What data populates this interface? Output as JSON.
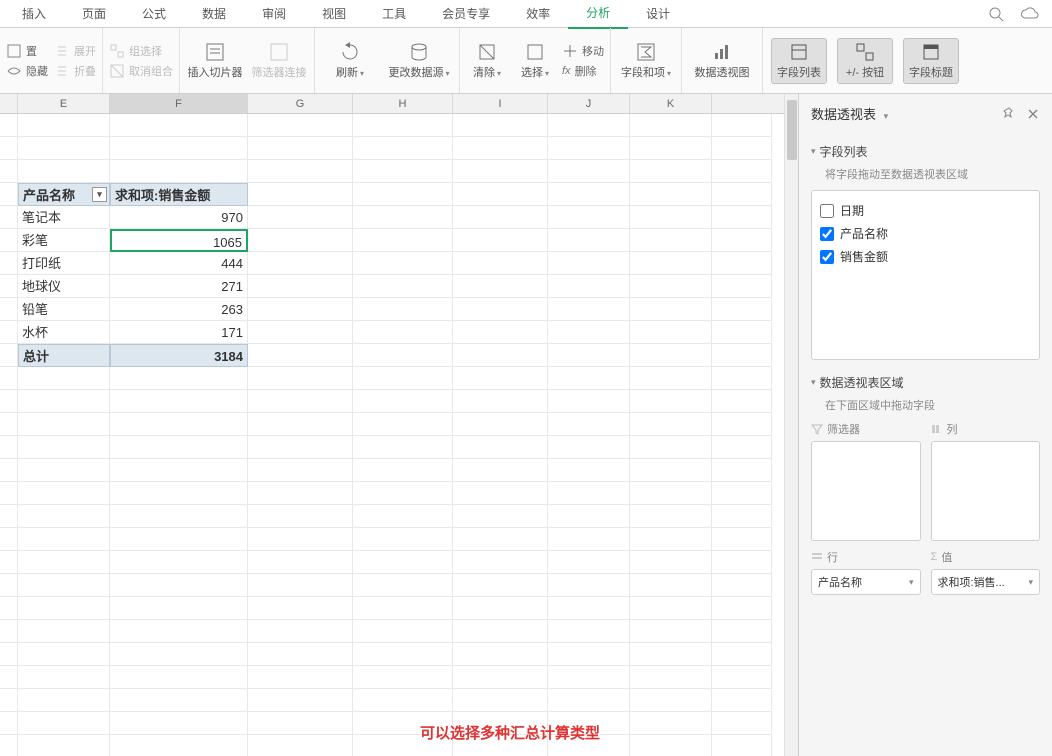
{
  "menu": {
    "items": [
      "插入",
      "页面",
      "公式",
      "数据",
      "审阅",
      "视图",
      "工具",
      "会员专享",
      "效率",
      "分析",
      "设计"
    ],
    "activeIndex": 9
  },
  "ribbon": {
    "left": {
      "set": "置",
      "hide": "隐藏",
      "expand": "展开",
      "collapse": "折叠"
    },
    "group2": {
      "select": "组选择",
      "ungroup": "取消组合"
    },
    "slicer": "插入切片器",
    "filterConn": "筛选器连接",
    "refresh": "刷新",
    "changeSource": "更改数据源",
    "clear": "清除",
    "selectAction": "选择",
    "move": "移动",
    "delete": "删除",
    "fxdelete": "fx",
    "fieldSum": "字段和项",
    "pivotChart": "数据透视图",
    "toggle1": "字段列表",
    "toggle2": "+/- 按钮",
    "toggle3": "字段标题"
  },
  "columns": [
    "",
    "E",
    "F",
    "G",
    "H",
    "I",
    "J",
    "K"
  ],
  "widths": [
    18,
    92,
    138,
    105,
    100,
    95,
    82,
    82,
    60
  ],
  "pivot": {
    "header1": "产品名称",
    "header2": "求和项:销售金额",
    "rows": [
      {
        "name": "笔记本",
        "val": "970"
      },
      {
        "name": "彩笔",
        "val": "1065"
      },
      {
        "name": "打印纸",
        "val": "444"
      },
      {
        "name": "地球仪",
        "val": "271"
      },
      {
        "name": "铅笔",
        "val": "263"
      },
      {
        "name": "水杯",
        "val": "171"
      }
    ],
    "totalLabel": "总计",
    "totalVal": "3184",
    "selectedRow": 1
  },
  "panel": {
    "title": "数据透视表",
    "fieldListTitle": "字段列表",
    "fieldHint": "将字段拖动至数据透视表区域",
    "fields": [
      {
        "label": "日期",
        "checked": false
      },
      {
        "label": "产品名称",
        "checked": true
      },
      {
        "label": "销售金额",
        "checked": true
      }
    ],
    "areaTitle": "数据透视表区域",
    "areaHint": "在下面区域中拖动字段",
    "filterLabel": "筛选器",
    "colLabel": "列",
    "rowLabel": "行",
    "valLabel": "值",
    "rowItem": "产品名称",
    "valItem": "求和项:销售..."
  },
  "note": "可以选择多种汇总计算类型"
}
